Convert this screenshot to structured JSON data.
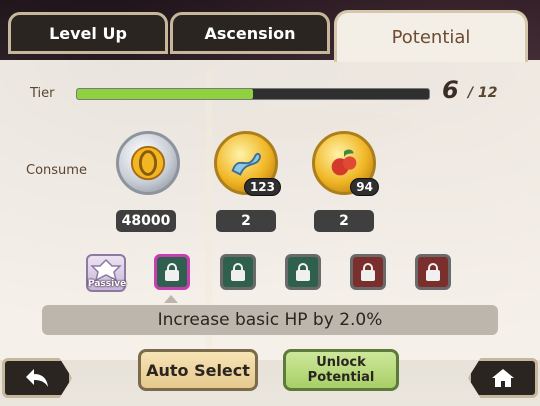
{
  "tabs": {
    "level_up": "Level Up",
    "ascension": "Ascension",
    "potential": "Potential"
  },
  "tier": {
    "label": "Tier",
    "current": "6",
    "max": "/ 12",
    "progress_fraction": 0.5
  },
  "consume": {
    "label": "Consume",
    "items": [
      {
        "icon": "gold-coin-icon",
        "owned": "",
        "required": "48000"
      },
      {
        "icon": "blue-dragon-icon",
        "owned": "123",
        "required": "2"
      },
      {
        "icon": "red-fruit-icon",
        "owned": "94",
        "required": "2"
      }
    ]
  },
  "slots": {
    "passive_label": "Passive",
    "items": [
      {
        "state": "locked",
        "color": "green",
        "selected": true
      },
      {
        "state": "locked",
        "color": "green",
        "selected": false
      },
      {
        "state": "locked",
        "color": "green",
        "selected": false
      },
      {
        "state": "locked",
        "color": "red",
        "selected": false
      },
      {
        "state": "locked",
        "color": "red",
        "selected": false
      }
    ]
  },
  "description": "Increase basic HP by 2.0%",
  "buttons": {
    "auto_select": "Auto Select",
    "unlock_line1": "Unlock",
    "unlock_line2": "Potential"
  },
  "colors": {
    "progress": "#8fd13f",
    "selected_outline": "#c63fb0"
  }
}
